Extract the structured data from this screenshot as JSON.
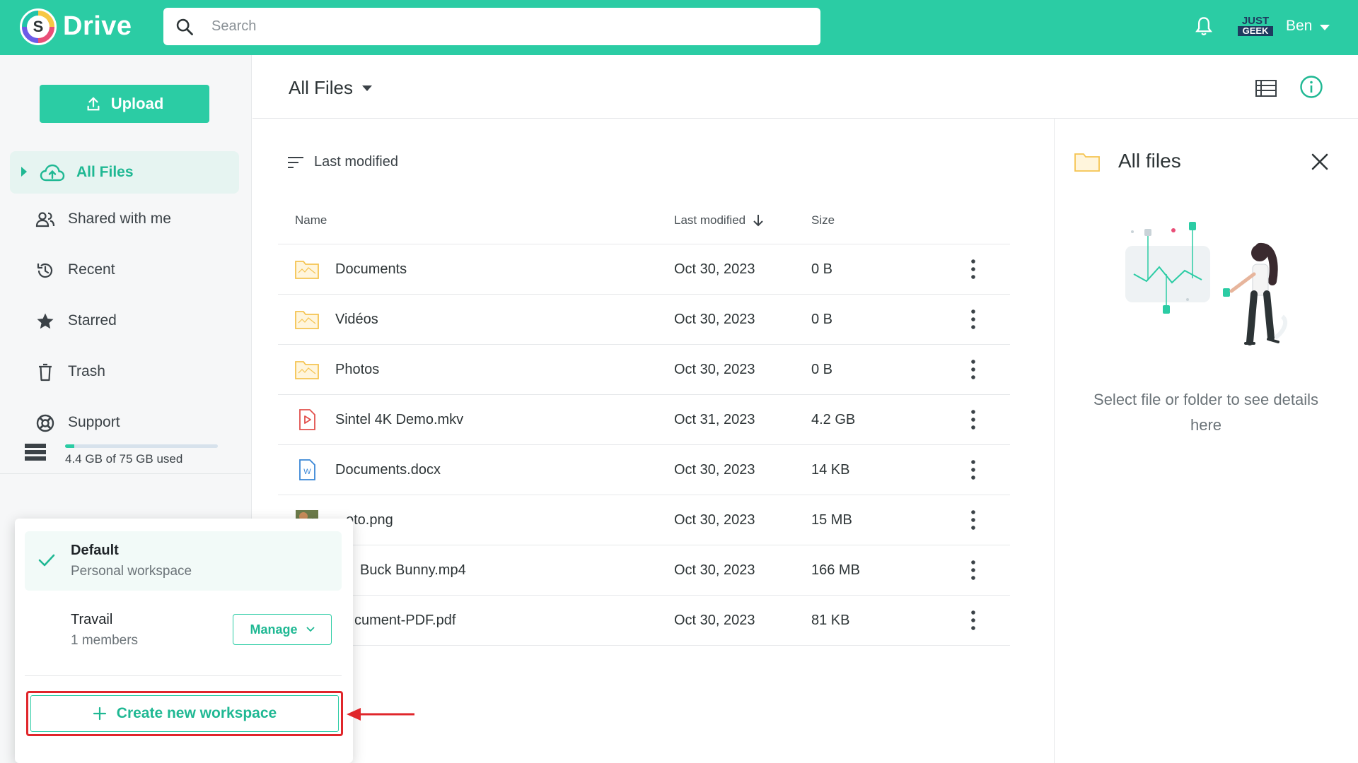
{
  "header": {
    "app_name": "Drive",
    "logo_letter": "S",
    "search_placeholder": "Search",
    "brand_top": "JUST",
    "brand_bottom": "GEEK",
    "user_name": "Ben"
  },
  "sidebar": {
    "upload_label": "Upload",
    "items": [
      {
        "label": "All Files",
        "icon": "cloud-upload-icon",
        "active": true
      },
      {
        "label": "Shared with me",
        "icon": "people-icon"
      },
      {
        "label": "Recent",
        "icon": "history-icon"
      },
      {
        "label": "Starred",
        "icon": "star-icon"
      },
      {
        "label": "Trash",
        "icon": "trash-icon"
      },
      {
        "label": "Support",
        "icon": "lifebuoy-icon"
      }
    ],
    "storage_text": "4.4 GB of 75 GB used",
    "storage_used_fraction": 0.059
  },
  "workspaces": {
    "items": [
      {
        "name": "Default",
        "subtitle": "Personal workspace",
        "selected": true
      },
      {
        "name": "Travail",
        "subtitle": "1 members",
        "action_label": "Manage"
      }
    ],
    "create_label": "Create new workspace"
  },
  "main": {
    "breadcrumb": "All Files",
    "sort_label": "Last modified",
    "columns": {
      "name": "Name",
      "modified": "Last modified",
      "size": "Size"
    },
    "files": [
      {
        "name": "Documents",
        "modified": "Oct 30, 2023",
        "size": "0 B",
        "type": "folder"
      },
      {
        "name": "Vidéos",
        "modified": "Oct 30, 2023",
        "size": "0 B",
        "type": "folder"
      },
      {
        "name": "Photos",
        "modified": "Oct 30, 2023",
        "size": "0 B",
        "type": "folder"
      },
      {
        "name": "Sintel 4K Demo.mkv",
        "modified": "Oct 31, 2023",
        "size": "4.2 GB",
        "type": "video"
      },
      {
        "name": "Documents.docx",
        "modified": "Oct 30, 2023",
        "size": "14 KB",
        "type": "word"
      },
      {
        "name": "oto.png",
        "modified": "Oct 30, 2023",
        "size": "15 MB",
        "type": "image"
      },
      {
        "name": "Buck Bunny.mp4",
        "modified": "Oct 30, 2023",
        "size": "166 MB",
        "type": "video"
      },
      {
        "name": "cument-PDF.pdf",
        "modified": "Oct 30, 2023",
        "size": "81 KB",
        "type": "pdf"
      }
    ]
  },
  "details": {
    "title": "All files",
    "message": "Select file or folder to see details here"
  },
  "colors": {
    "accent": "#2bcca4",
    "accent_dark": "#1fb893",
    "highlight": "#e0262b",
    "folder": "#f5c451"
  }
}
